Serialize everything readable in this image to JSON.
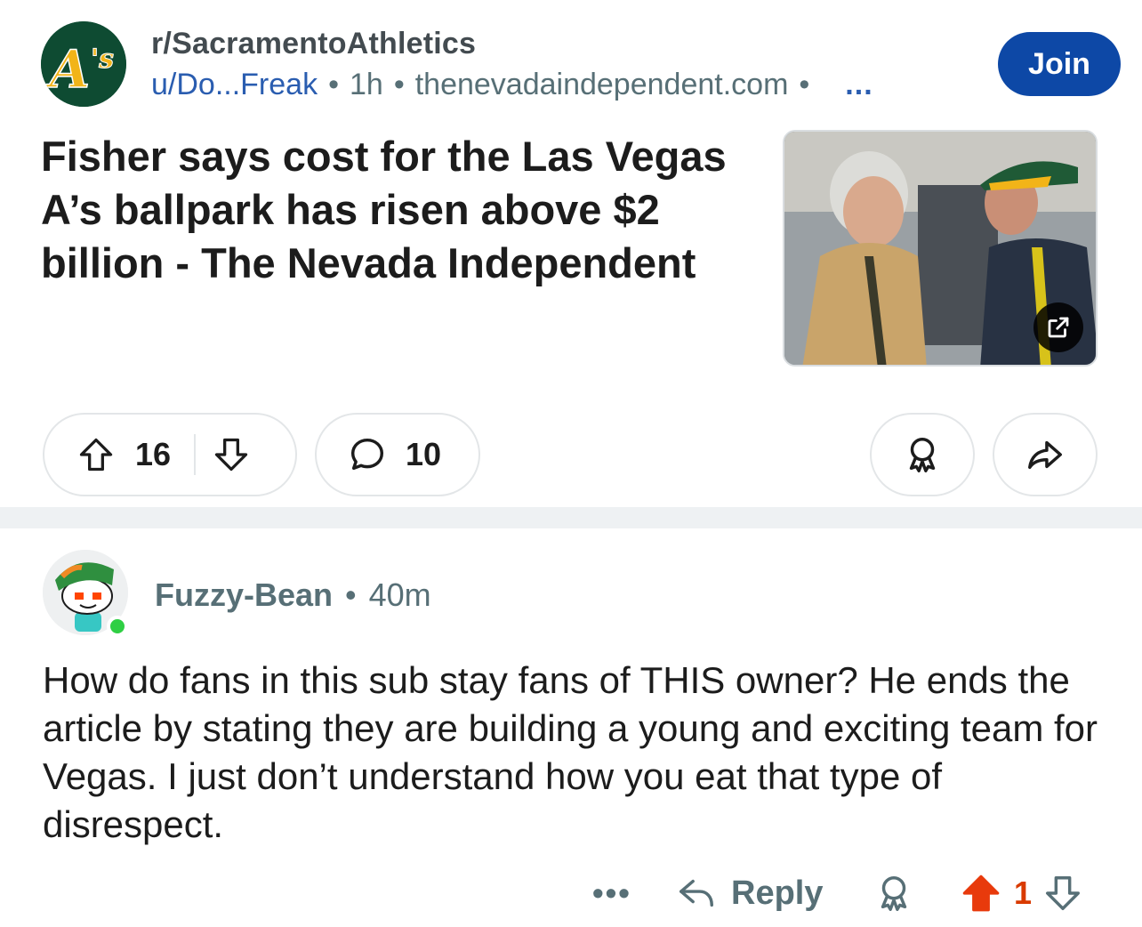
{
  "post": {
    "subreddit": "r/SacramentoAthletics",
    "subreddit_logo_text": "A's",
    "author": "u/Do...Freak",
    "age": "1h",
    "domain": "thenevadaindependent.com",
    "separator": "•",
    "more": "...",
    "join_label": "Join",
    "title": "Fisher says cost for the Las Vegas A’s ballpark has risen above $2 billion - The Nevada Independent",
    "upvotes": "16",
    "comments": "10"
  },
  "comment": {
    "author": "Fuzzy-Bean",
    "separator": "•",
    "age": "40m",
    "body": "How do fans in this sub stay fans of THIS owner? He ends the article by stating they are building a young and exciting team for Vegas. I just don’t understand how you eat that type of disrespect.",
    "more": "•••",
    "reply_label": "Reply",
    "score": "1"
  },
  "colors": {
    "join_bg": "#0d48a6",
    "link_blue": "#2a5db0",
    "upvote_active": "#e83a0c",
    "online": "#2fcf44",
    "divider": "#eef1f3",
    "logo_green": "#0e4b32",
    "logo_gold": "#f2b418"
  },
  "icons": [
    "upvote-icon",
    "downvote-icon",
    "comment-icon",
    "award-icon",
    "share-icon",
    "external-link-icon",
    "reply-icon"
  ]
}
